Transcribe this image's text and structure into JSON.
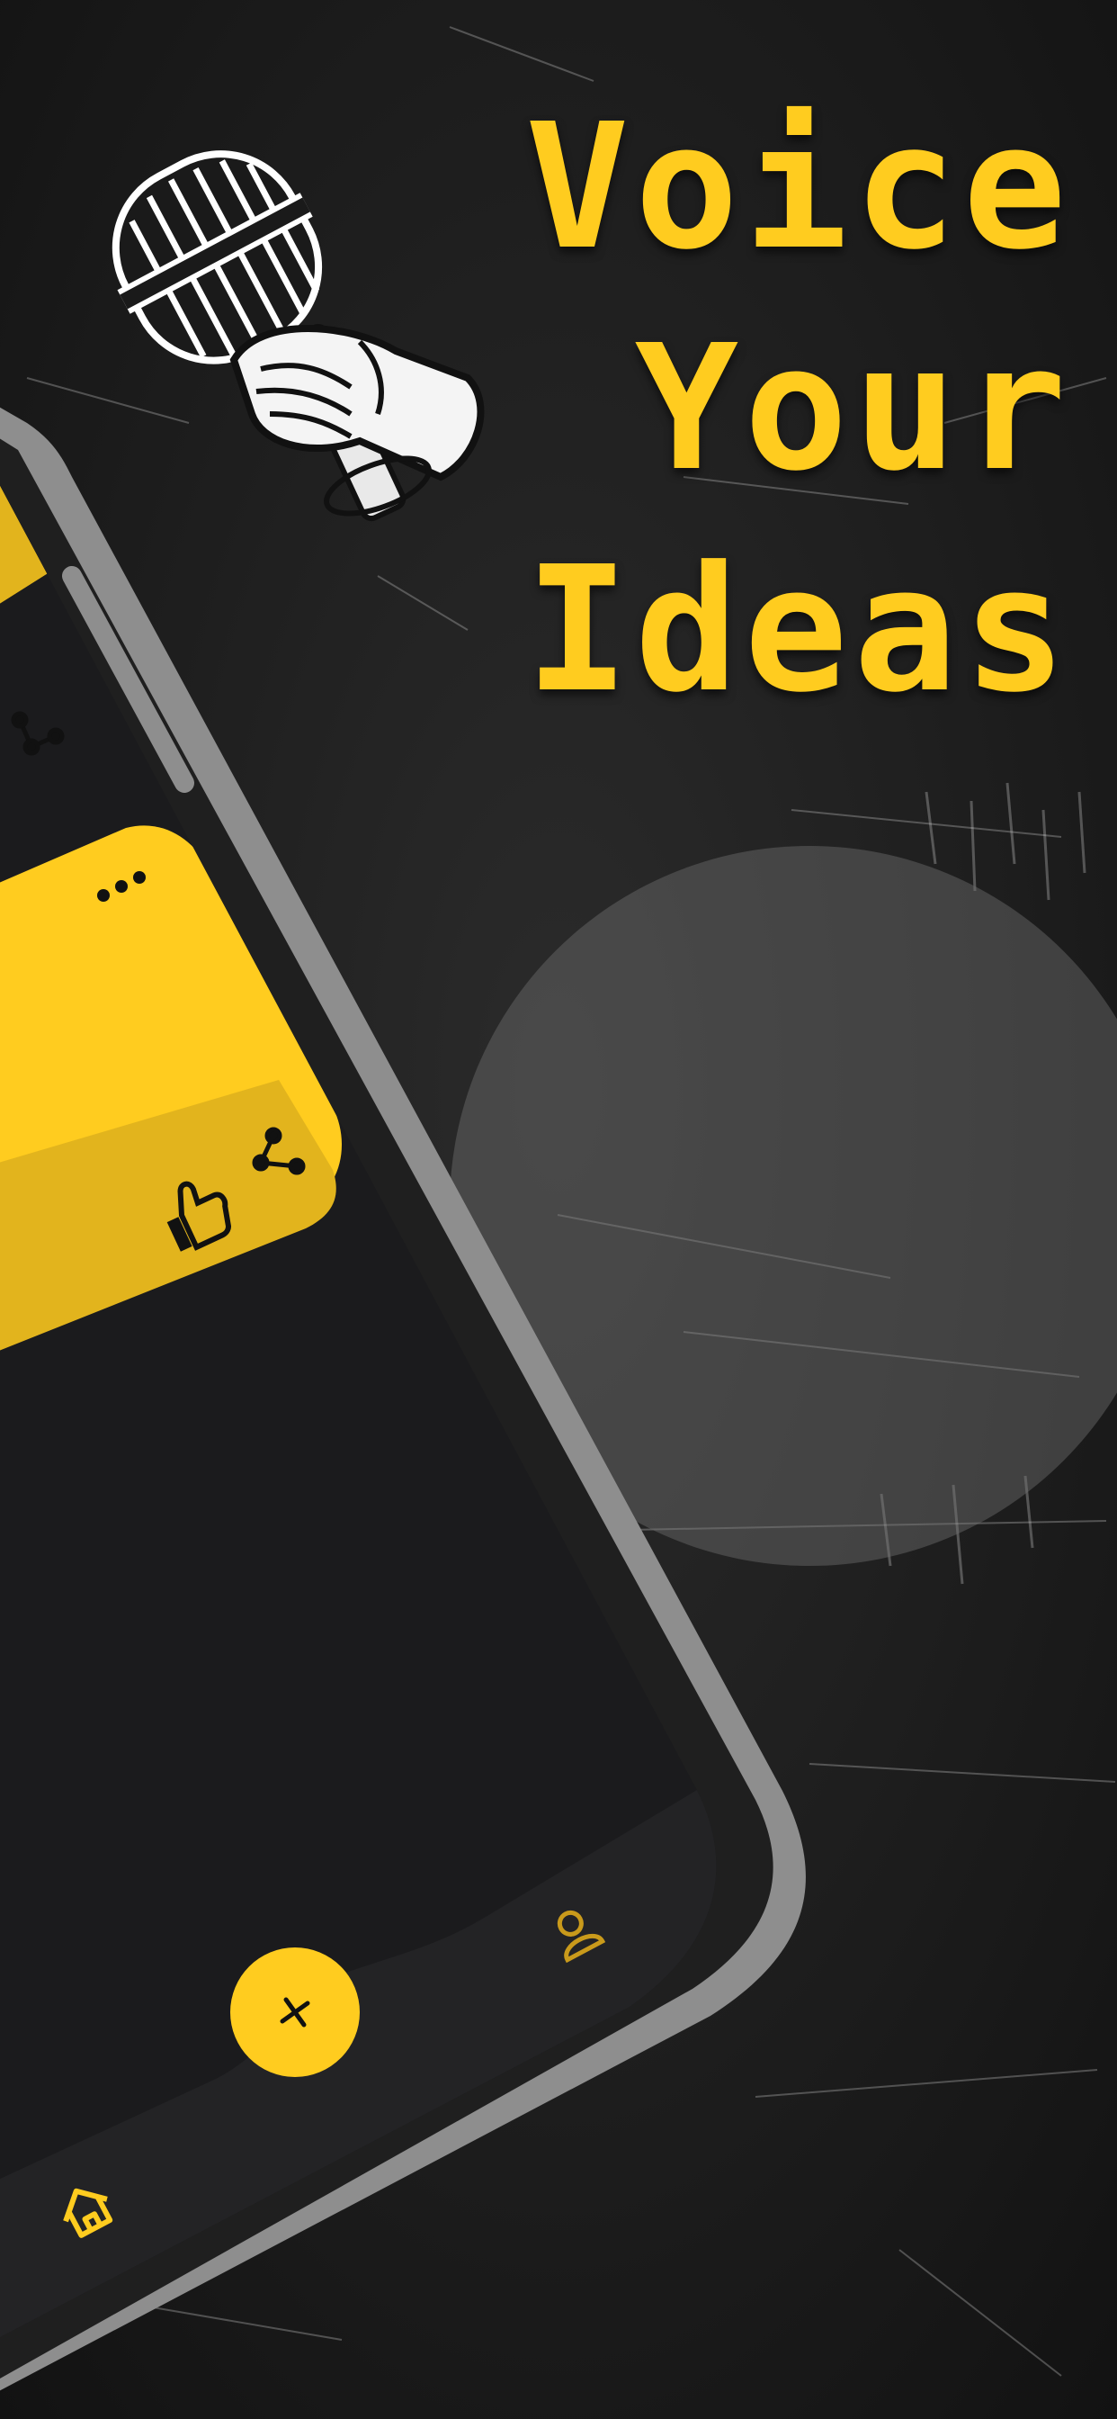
{
  "headline": {
    "line1": "Voice",
    "line2": "Your",
    "line3": "Ideas"
  },
  "colors": {
    "accent": "#ffcc1f",
    "accent_dark": "#e2b41d",
    "background": "#1c1c1c",
    "phone_frame": "#8e8e8e",
    "screen": "#1b1b1d",
    "tab_bar": "#202022",
    "overlay_circle": "#6e6e6e"
  },
  "phone": {
    "cards": [
      {
        "more_icon": "more-dots-icon",
        "actions": [
          "share-icon"
        ]
      },
      {
        "more_icon": "more-dots-icon",
        "actions": [
          "thumbs-up-icon",
          "share-icon"
        ]
      }
    ],
    "tab_bar": {
      "items": [
        {
          "icon": "home-icon"
        },
        {
          "icon": "add-icon"
        },
        {
          "icon": "profile-icon"
        }
      ]
    }
  }
}
